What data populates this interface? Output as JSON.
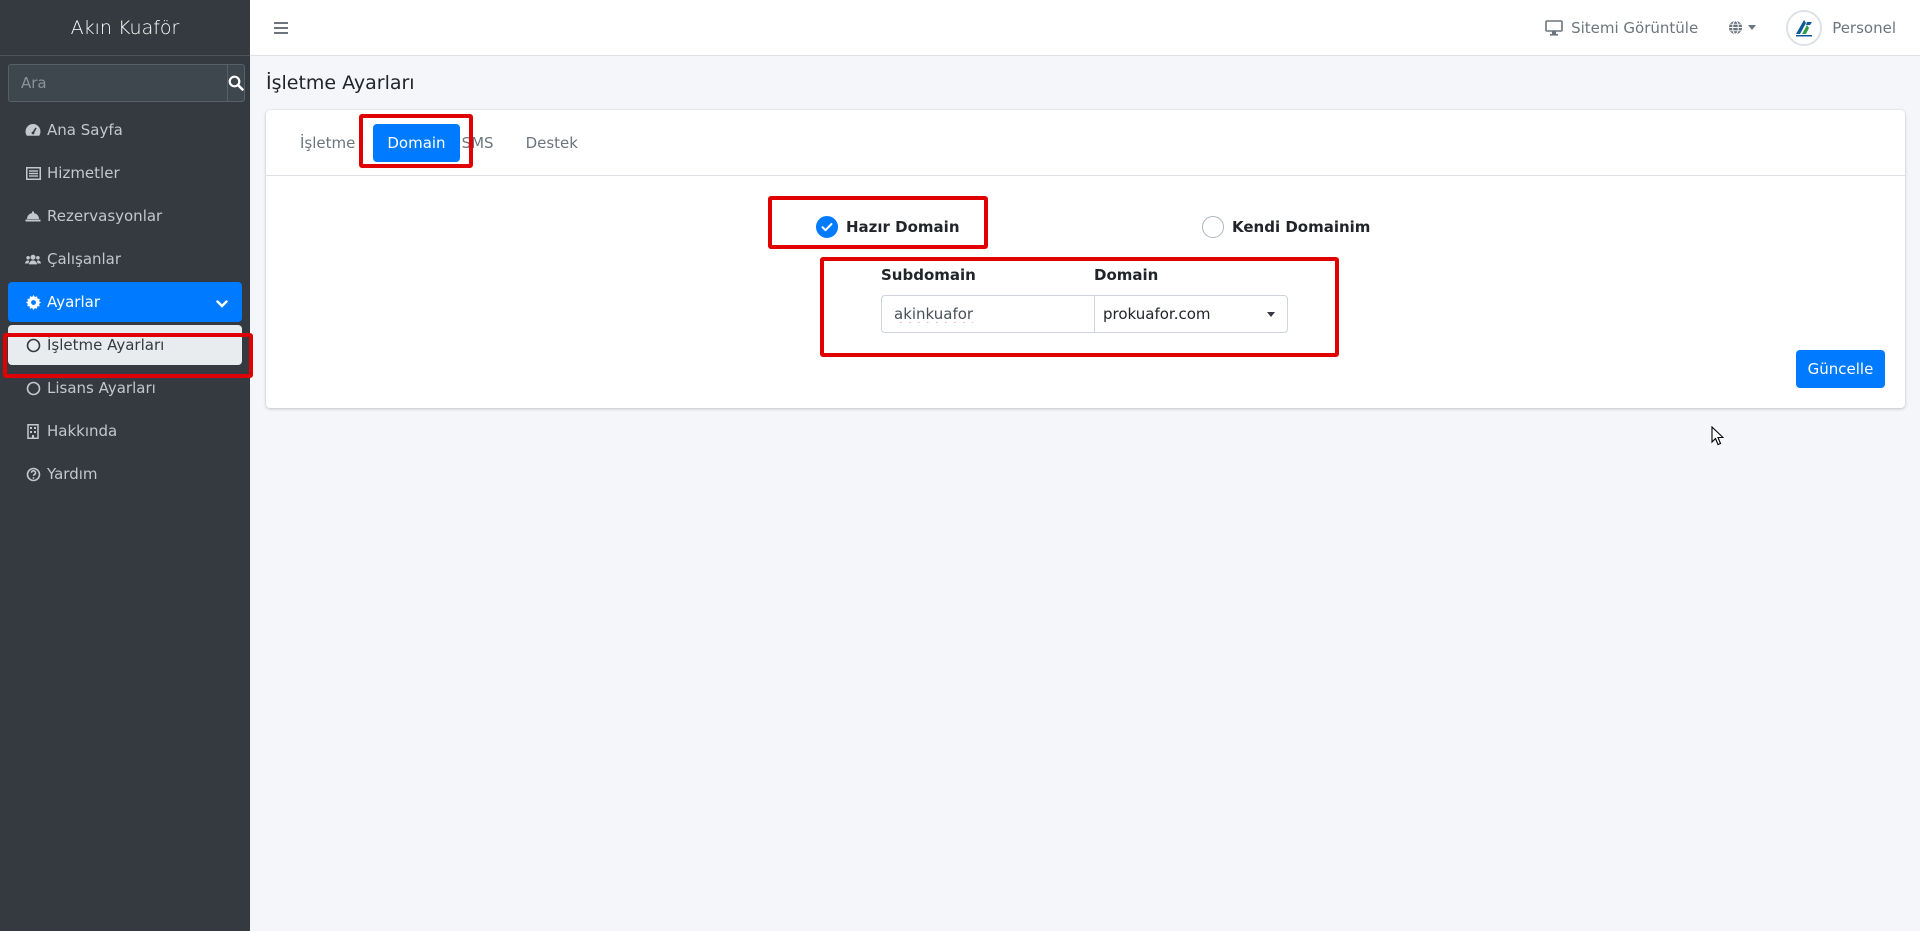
{
  "sidebar": {
    "brand": "Akın Kuaför",
    "search_placeholder": "Ara",
    "items": [
      {
        "label": "Ana Sayfa",
        "icon": "dashboard-icon"
      },
      {
        "label": "Hizmetler",
        "icon": "list-icon"
      },
      {
        "label": "Rezervasyonlar",
        "icon": "bell-icon"
      },
      {
        "label": "Çalışanlar",
        "icon": "users-icon"
      },
      {
        "label": "Ayarlar",
        "icon": "gear-icon",
        "active": true
      },
      {
        "label": "İşletme Ayarları",
        "icon": "circle-icon",
        "sub_active": true
      },
      {
        "label": "Lisans Ayarları",
        "icon": "circle-icon"
      },
      {
        "label": "Hakkında",
        "icon": "building-icon"
      },
      {
        "label": "Yardım",
        "icon": "question-circle-icon"
      }
    ]
  },
  "header": {
    "view_site": "Sitemi Görüntüle",
    "user_name": "Personel"
  },
  "page": {
    "title": "İşletme Ayarları"
  },
  "tabs": [
    {
      "label": "İşletme"
    },
    {
      "label": "Domain",
      "active": true
    },
    {
      "label": "SMS"
    },
    {
      "label": "Destek"
    }
  ],
  "domain_form": {
    "option_ready": "Hazır Domain",
    "option_own": "Kendi Domainim",
    "selected_option": "Hazır Domain",
    "subdomain_label": "Subdomain",
    "subdomain_value": "akinkuafor",
    "domain_label": "Domain",
    "domain_value": "prokuafor.com",
    "submit_label": "Güncelle"
  },
  "colors": {
    "primary": "#007bff",
    "sidebar_bg": "#343a40",
    "highlight": "#e00000"
  }
}
